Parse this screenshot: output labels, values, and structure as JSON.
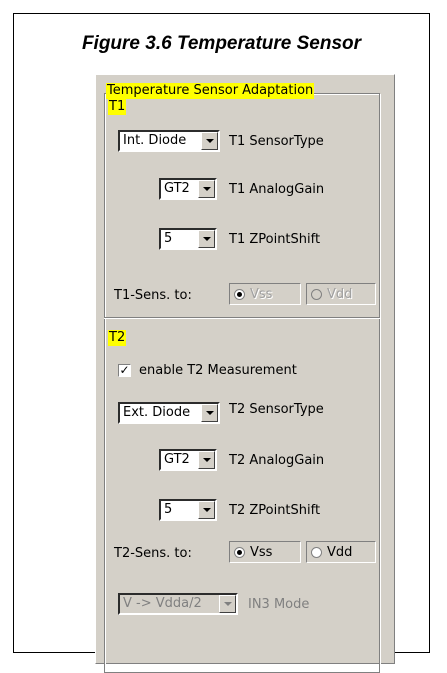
{
  "figure": {
    "caption": "Figure 3.6   Temperature Sensor"
  },
  "group": {
    "title": "Temperature Sensor Adaptation"
  },
  "t1": {
    "section_label": "T1",
    "sensor_type": {
      "value": "Int. Diode",
      "label": "T1 SensorType"
    },
    "analog_gain": {
      "value": "GT2",
      "label": "T1 AnalogGain"
    },
    "zpoint_shift": {
      "value": "5",
      "label": "T1 ZPointShift"
    },
    "sens_to": {
      "label": "T1-Sens. to:",
      "options": [
        "Vss",
        "Vdd"
      ],
      "selected": "Vss"
    }
  },
  "t2": {
    "section_label": "T2",
    "enable": {
      "label": "enable T2 Measurement",
      "checked": true,
      "mark": "✓"
    },
    "sensor_type": {
      "value": "Ext. Diode",
      "label": "T2 SensorType"
    },
    "analog_gain": {
      "value": "GT2",
      "label": "T2 AnalogGain"
    },
    "zpoint_shift": {
      "value": "5",
      "label": "T2 ZPointShift"
    },
    "sens_to": {
      "label": "T2-Sens. to:",
      "options": [
        "Vss",
        "Vdd"
      ],
      "selected": "Vss"
    }
  },
  "in3": {
    "value": "V -> Vdda/2",
    "label": "IN3 Mode"
  },
  "colors": {
    "highlight": "#ffff00",
    "panel_bg": "#d4d0c8"
  }
}
